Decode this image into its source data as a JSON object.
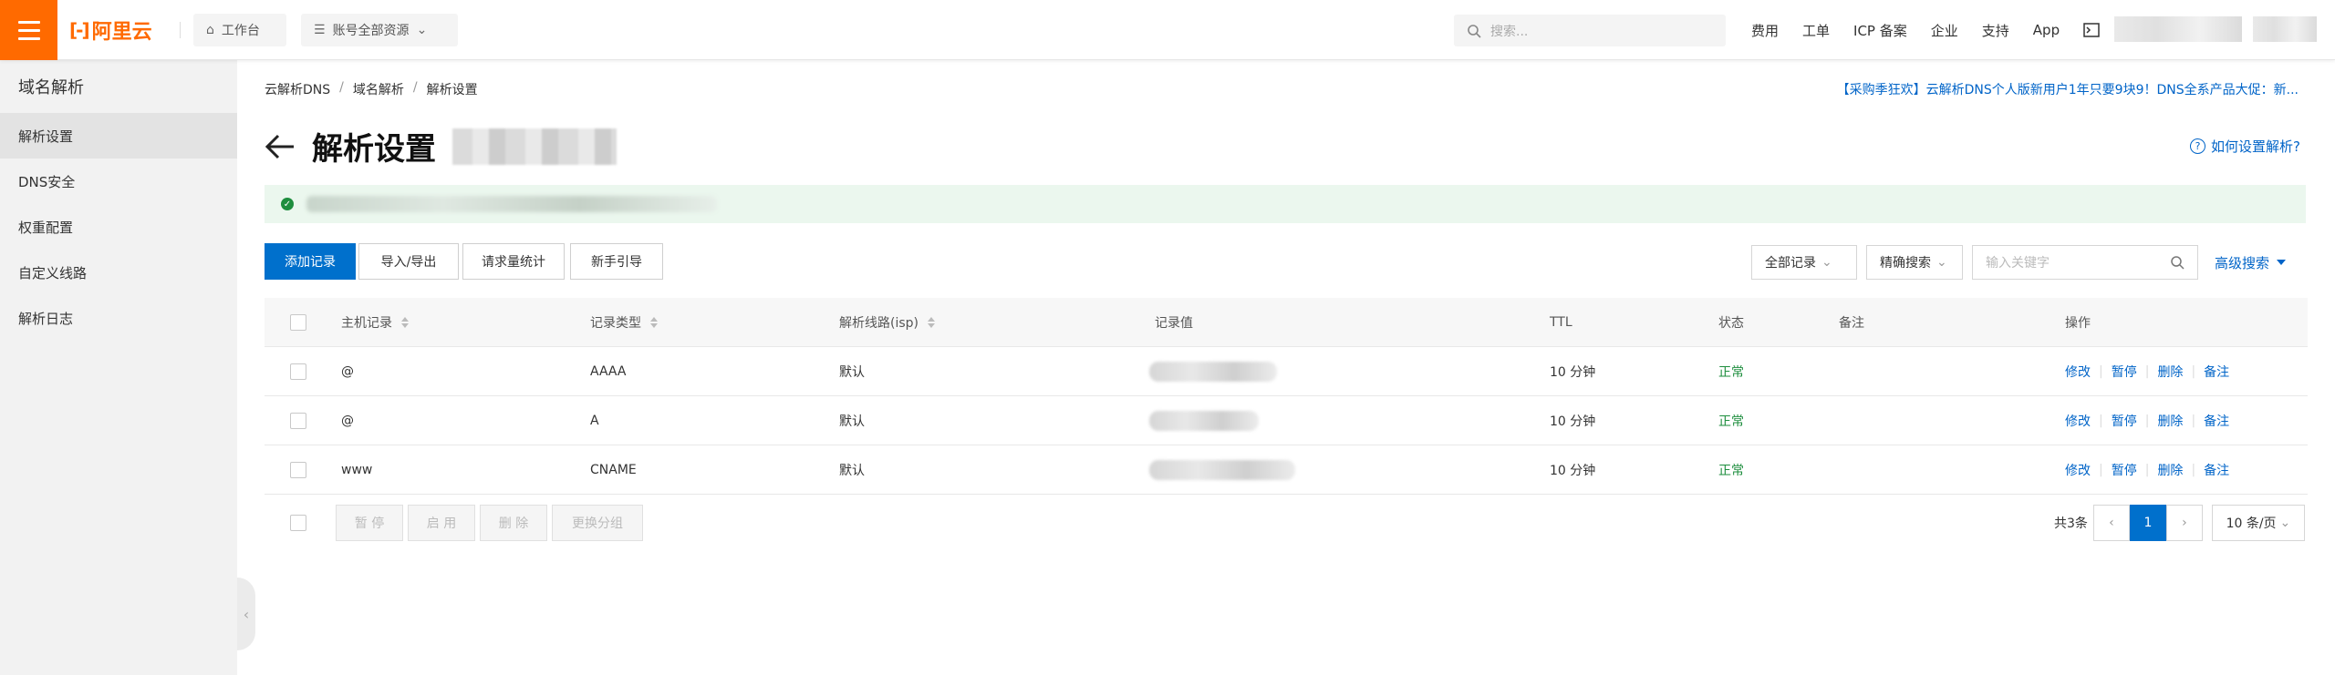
{
  "topbar": {
    "logo_text": "阿里云",
    "workbench": "工作台",
    "resources": "账号全部资源",
    "search_placeholder": "搜索...",
    "links": [
      "费用",
      "工单",
      "ICP 备案",
      "企业",
      "支持",
      "App"
    ]
  },
  "sidebar": {
    "title": "域名解析",
    "items": [
      "解析设置",
      "DNS安全",
      "权重配置",
      "自定义线路",
      "解析日志"
    ],
    "active_index": 0
  },
  "breadcrumb": [
    "云解析DNS",
    "域名解析",
    "解析设置"
  ],
  "promo": "【采购季狂欢】云解析DNS个人版新用户1年只要9块9！DNS全系产品大促：新...",
  "page_title": "解析设置",
  "help_link": "如何设置解析?",
  "toolbar": {
    "add_record": "添加记录",
    "import_export": "导入/导出",
    "request_stats": "请求量统计",
    "newbie_guide": "新手引导",
    "record_filter": "全部记录",
    "search_mode": "精确搜索",
    "keyword_placeholder": "输入关键字",
    "advanced_search": "高级搜索"
  },
  "table": {
    "columns": [
      "主机记录",
      "记录类型",
      "解析线路(isp)",
      "记录值",
      "TTL",
      "状态",
      "备注",
      "操作"
    ],
    "rows": [
      {
        "host": "@",
        "type": "AAAA",
        "line": "默认",
        "ttl": "10 分钟",
        "status": "正常",
        "remark": ""
      },
      {
        "host": "@",
        "type": "A",
        "line": "默认",
        "ttl": "10 分钟",
        "status": "正常",
        "remark": ""
      },
      {
        "host": "www",
        "type": "CNAME",
        "line": "默认",
        "ttl": "10 分钟",
        "status": "正常",
        "remark": ""
      }
    ],
    "actions": [
      "修改",
      "暂停",
      "删除",
      "备注"
    ]
  },
  "bulk_actions": [
    "暂 停",
    "启 用",
    "删 除",
    "更换分组"
  ],
  "pagination": {
    "total": "共3条",
    "current_page": "1",
    "page_size": "10 条/页"
  },
  "colors": {
    "brand": "#ff6a00",
    "primary": "#0070cc",
    "link": "#0064c8",
    "status_ok": "#1e8e3e"
  }
}
